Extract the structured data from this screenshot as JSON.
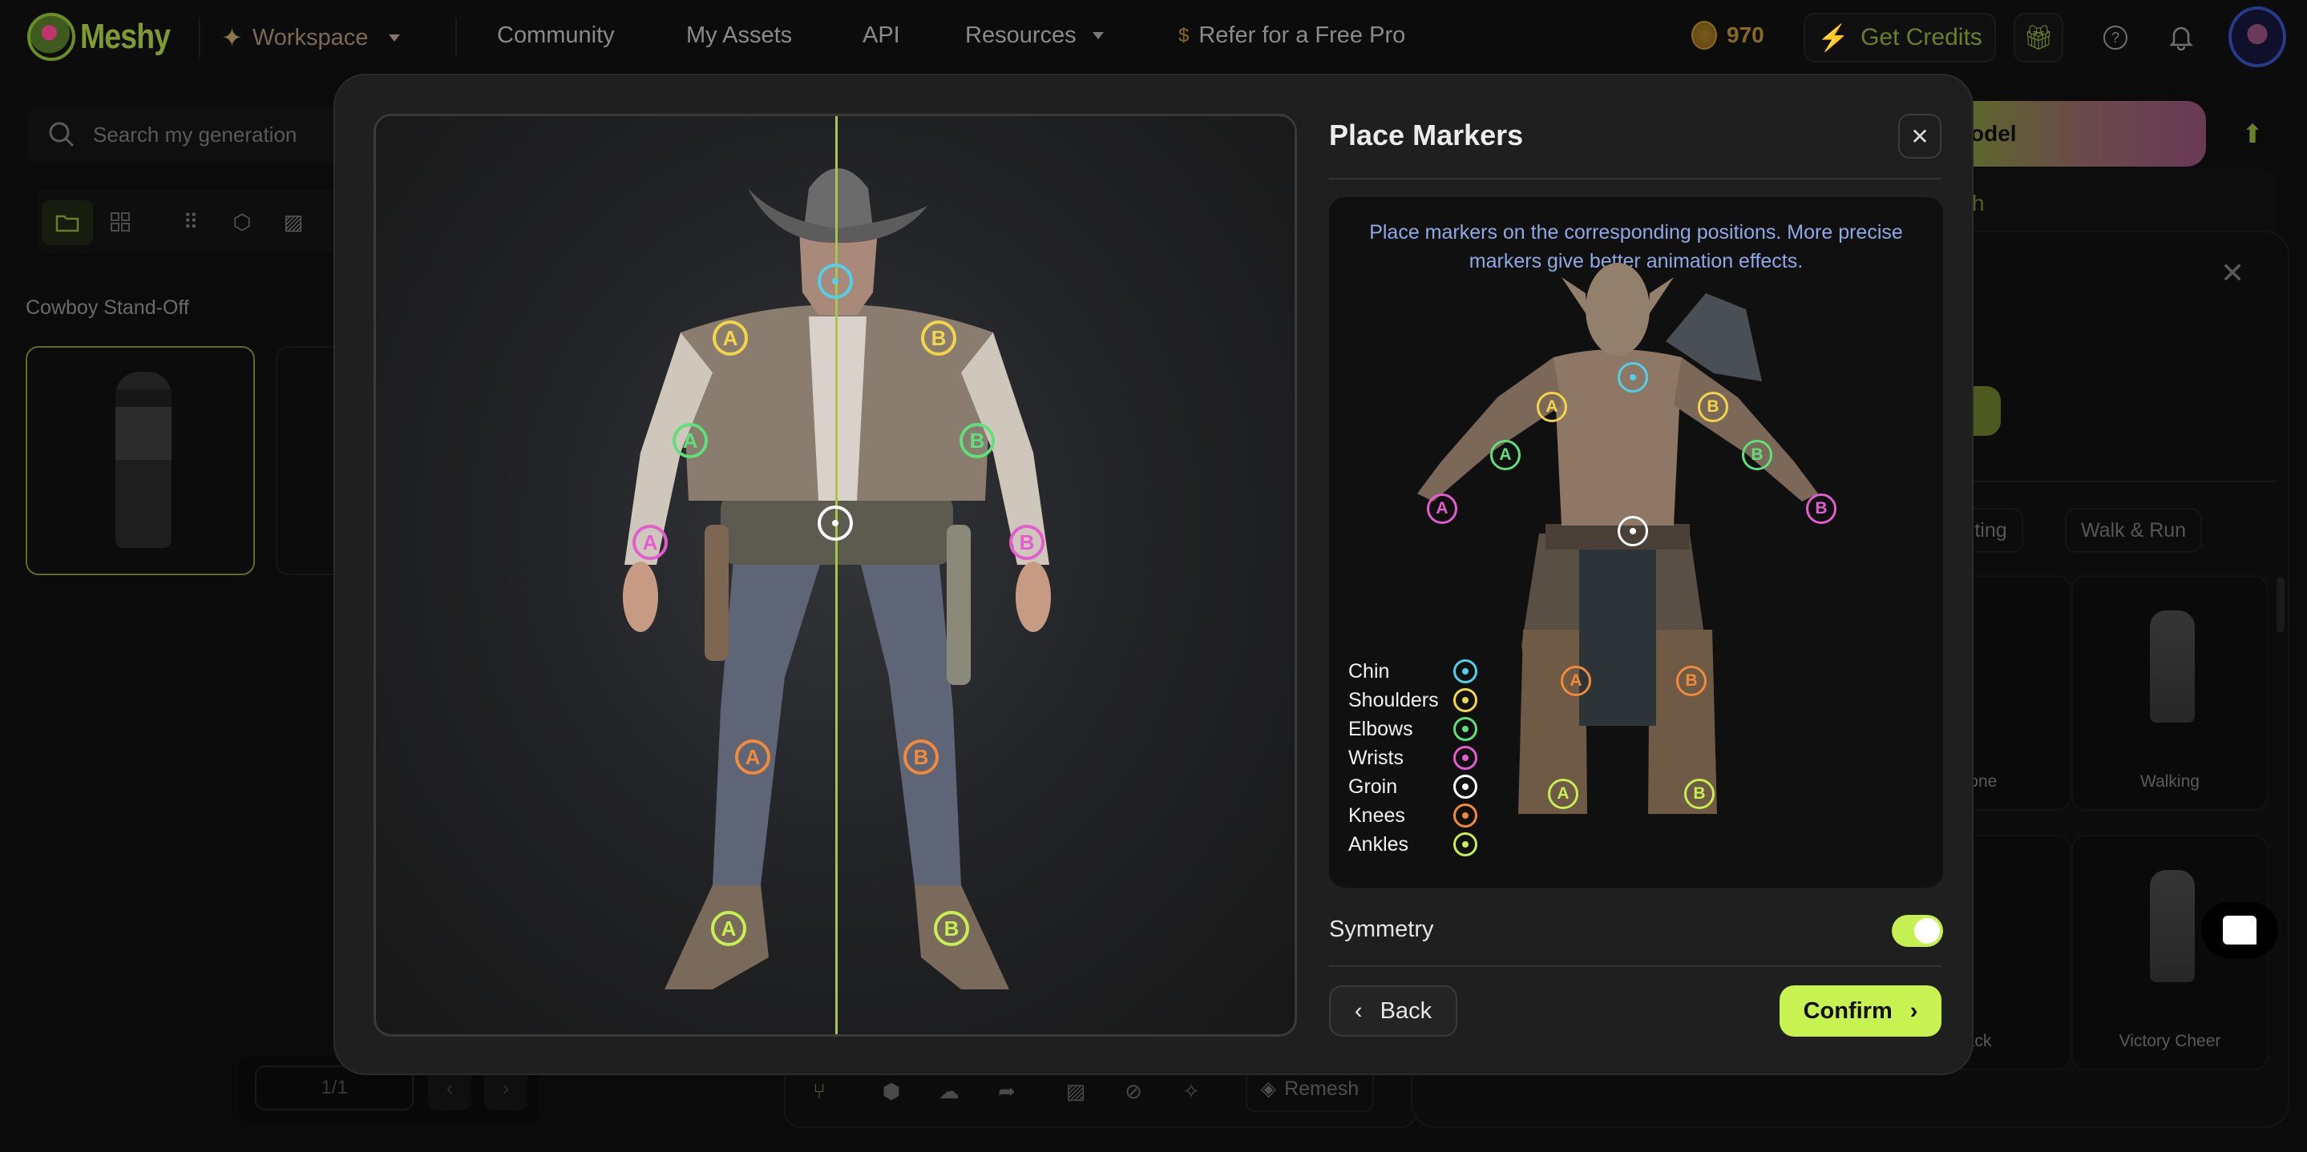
{
  "brand": {
    "name": "Meshy",
    "accent": "#c8f152"
  },
  "nav": {
    "workspace": "Workspace",
    "community": "Community",
    "my_assets": "My Assets",
    "api": "API",
    "resources": "Resources",
    "refer": "Refer for a Free Pro",
    "credits": "970",
    "get_credits": "Get Credits"
  },
  "sidebar": {
    "search_placeholder": "Search my generation",
    "group_title": "Cowboy Stand-Off",
    "pager": "1/1"
  },
  "toolbar": {
    "remesh": "Remesh"
  },
  "right": {
    "generate_label": "odel",
    "field_text": "h",
    "chips": [
      "ighting",
      "Walk & Run"
    ],
    "animations": [
      "Phone",
      "Walking",
      "Back",
      "Victory Cheer"
    ]
  },
  "modal": {
    "title": "Place Markers",
    "hint": "Place markers on the corresponding positions. More precise markers give better animation effects.",
    "legend": [
      {
        "label": "Chin",
        "color": "#4fd1ea"
      },
      {
        "label": "Shoulders",
        "color": "#f2d64a"
      },
      {
        "label": "Elbows",
        "color": "#5fe07a"
      },
      {
        "label": "Wrists",
        "color": "#e45ccf"
      },
      {
        "label": "Groin",
        "color": "#ffffff"
      },
      {
        "label": "Knees",
        "color": "#f28a3a"
      },
      {
        "label": "Ankles",
        "color": "#c6ef51"
      }
    ],
    "markers": [
      {
        "joint": "Chin",
        "side": ""
      },
      {
        "joint": "Shoulders",
        "side": "A"
      },
      {
        "joint": "Shoulders",
        "side": "B"
      },
      {
        "joint": "Elbows",
        "side": "A"
      },
      {
        "joint": "Elbows",
        "side": "B"
      },
      {
        "joint": "Wrists",
        "side": "A"
      },
      {
        "joint": "Wrists",
        "side": "B"
      },
      {
        "joint": "Groin",
        "side": ""
      },
      {
        "joint": "Knees",
        "side": "A"
      },
      {
        "joint": "Knees",
        "side": "B"
      },
      {
        "joint": "Ankles",
        "side": "A"
      },
      {
        "joint": "Ankles",
        "side": "B"
      }
    ],
    "symmetry_label": "Symmetry",
    "symmetry_on": true,
    "back_label": "Back",
    "confirm_label": "Confirm"
  }
}
